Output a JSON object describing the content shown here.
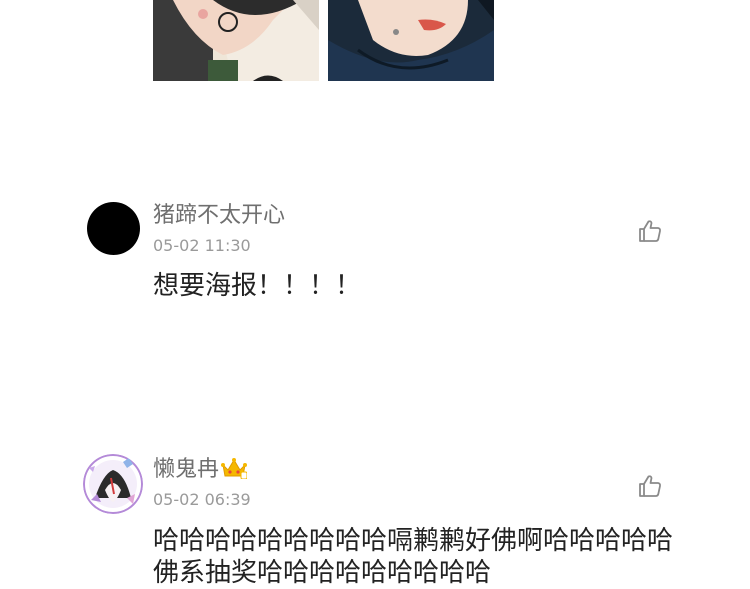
{
  "images": [
    {
      "name": "comment-image-1"
    },
    {
      "name": "comment-image-2"
    }
  ],
  "comments": [
    {
      "username": "猪蹄不太开心",
      "timestamp": "05-02 11:30",
      "text": "想要海报！！！！",
      "avatar_color": "#000000"
    },
    {
      "username": "懒鬼冉",
      "badge_icon": "crown-icon",
      "timestamp": "05-02 06:39",
      "text": "哈哈哈哈哈哈哈哈哈嗝鹣鹣好佛啊哈哈哈哈哈佛系抽奖哈哈哈哈哈哈哈哈哈"
    }
  ],
  "icons": {
    "like": "thumbs-up-icon"
  },
  "colors": {
    "username": "#6f6f6f",
    "timestamp": "#9a9a9a",
    "text": "#222222",
    "crown": "#f5b800"
  }
}
